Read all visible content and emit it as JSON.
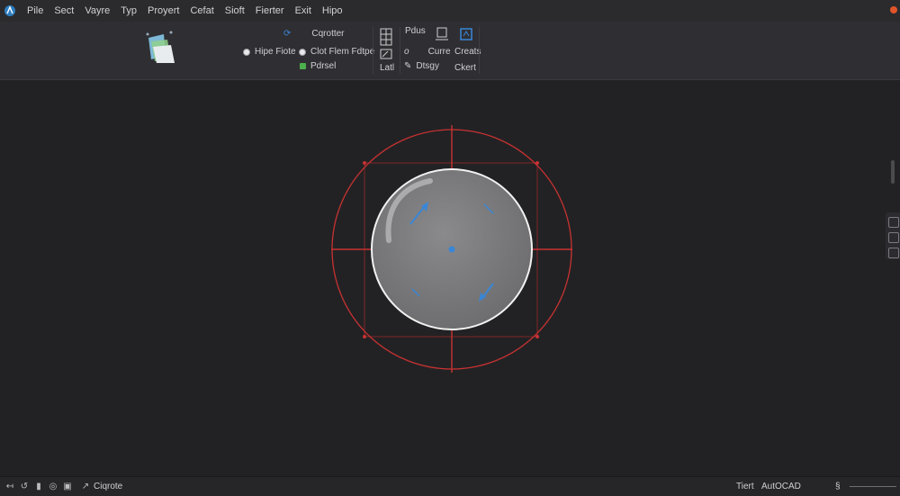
{
  "menu": {
    "items": [
      "Pile",
      "Sect",
      "Vayre",
      "Typ",
      "Proyert",
      "Cefat",
      "Sioft",
      "Fierter",
      "Exit",
      "Hipo"
    ]
  },
  "ribbon": {
    "radio_label": "Hipe Fiote",
    "square_label": "Cqrotter",
    "radio2_label": "Clot Flem Fdtpe",
    "green_label": "Pdrsel",
    "lat_label": "Latl",
    "plus_label": "Pdus",
    "curve_label": "Curre",
    "create_label": "Creats",
    "dtsgy_label": "Dtsgy",
    "chart_label": "Ckert"
  },
  "status": {
    "command_label": "Ciqrote",
    "text_label": "Tiert",
    "app_name": "AutOCAD",
    "right_glyph": "§"
  },
  "colors": {
    "accent": "#3a86d6",
    "red_grid": "#c83232",
    "sphere": "#7b7b7d"
  }
}
